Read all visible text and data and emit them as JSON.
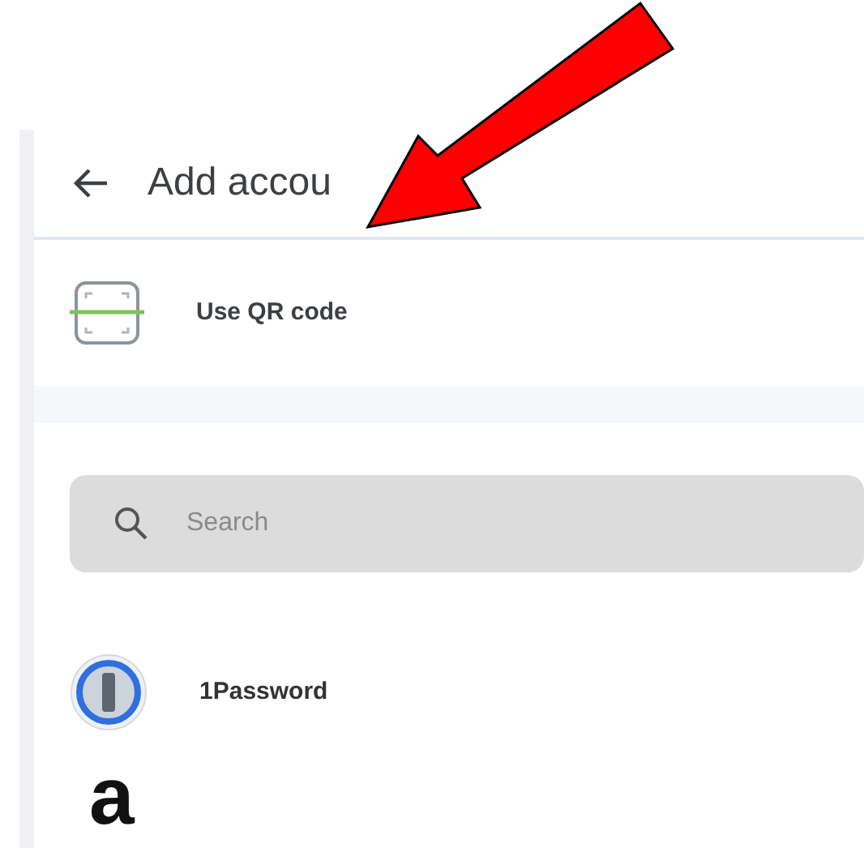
{
  "header": {
    "title": "Add accou"
  },
  "qr_option": {
    "label": "Use QR code"
  },
  "search": {
    "placeholder": "Search"
  },
  "accounts": [
    {
      "kind": "ring",
      "name": "1Password"
    },
    {
      "kind": "letter",
      "logo": "a"
    }
  ]
}
